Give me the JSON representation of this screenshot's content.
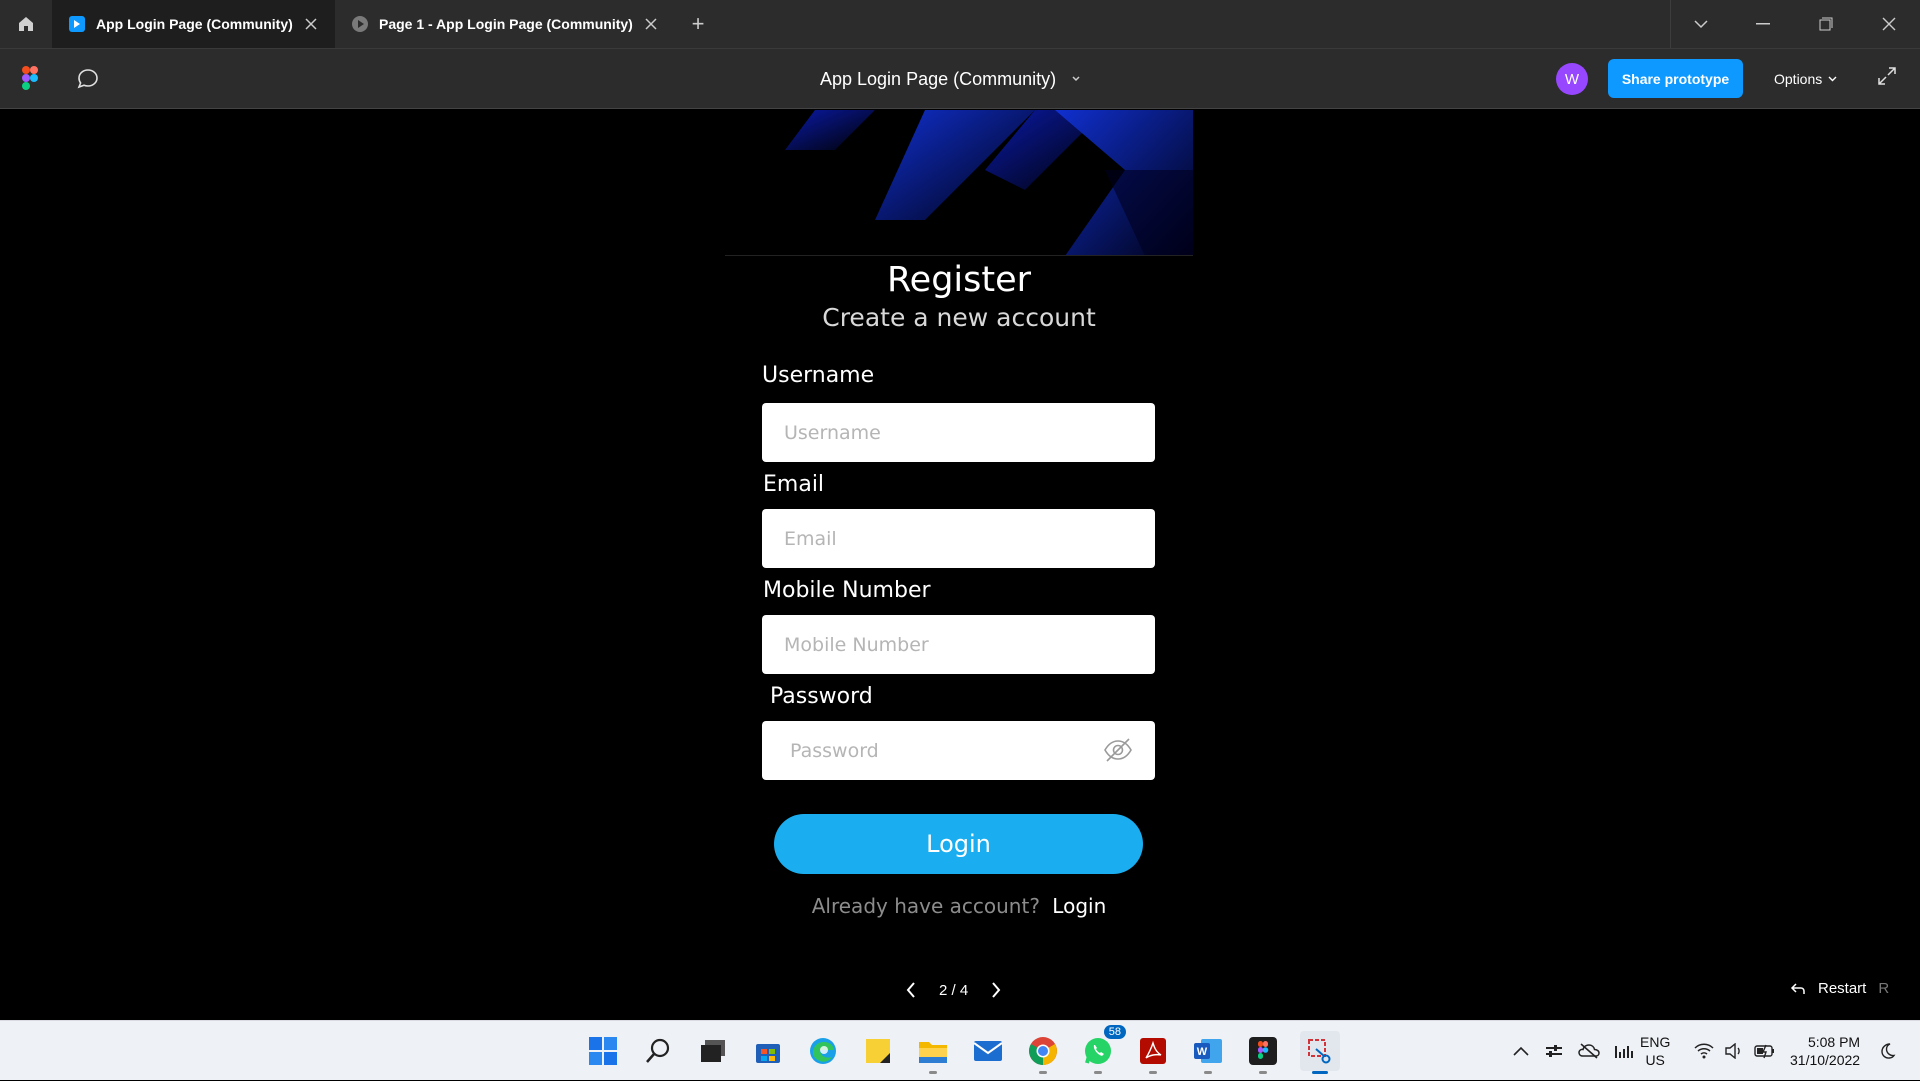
{
  "browser": {
    "tabs": [
      {
        "label": "App Login Page (Community)",
        "active": true
      },
      {
        "label": "Page 1 - App Login Page (Community)",
        "active": false
      }
    ],
    "new_tab": "+"
  },
  "toolbar": {
    "file_title": "App Login Page (Community)",
    "avatar_initial": "W",
    "share_label": "Share prototype",
    "options_label": "Options"
  },
  "form": {
    "title": "Register",
    "subtitle": "Create a new account",
    "fields": [
      {
        "label": "Username",
        "placeholder": "Username"
      },
      {
        "label": "Email",
        "placeholder": "Email"
      },
      {
        "label": "Mobile Number",
        "placeholder": "Mobile Number"
      },
      {
        "label": "Password",
        "placeholder": "Password"
      }
    ],
    "submit_label": "Login",
    "already_text": "Already have account?",
    "login_link": "Login"
  },
  "prototype": {
    "page_indicator": "2 / 4",
    "restart_label": "Restart",
    "restart_key": "R"
  },
  "taskbar": {
    "whatsapp_badge": "58",
    "lang_top": "ENG",
    "lang_bottom": "US",
    "time": "5:08 PM",
    "date": "31/10/2022"
  },
  "colors": {
    "accent": "#1aaef0",
    "figma_blue": "#0d99ff",
    "avatar": "#9747ff"
  }
}
